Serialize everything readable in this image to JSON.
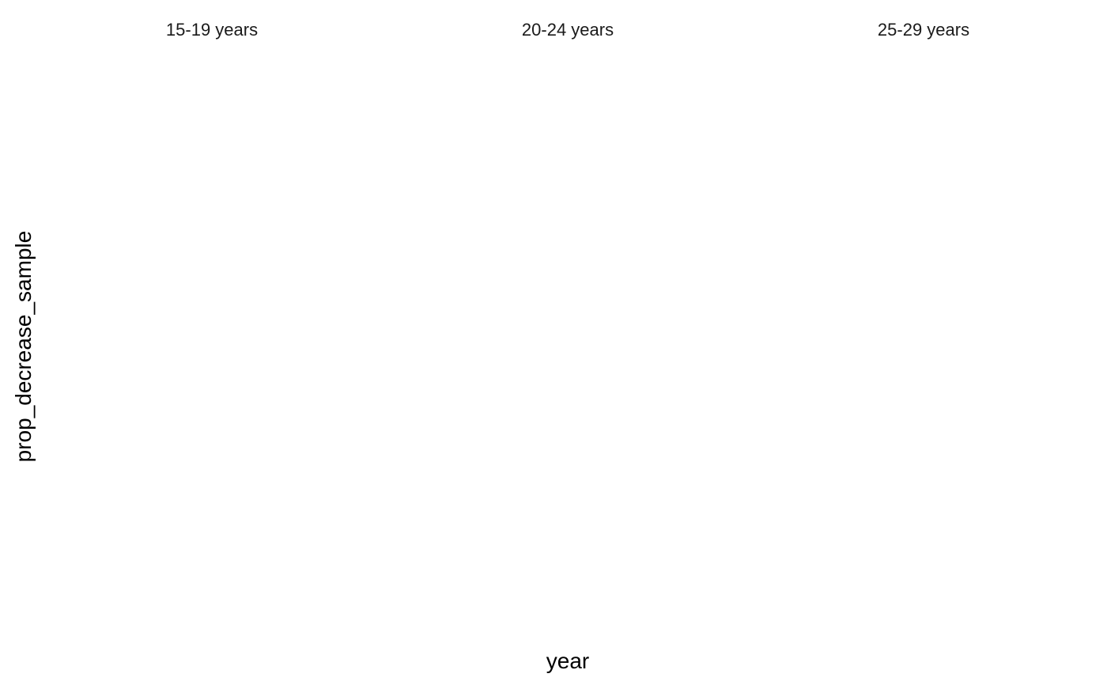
{
  "chart_data": {
    "type": "line",
    "facets": [
      "15-19 years",
      "20-24 years",
      "25-29 years"
    ],
    "xlabel": "year",
    "ylabel": "prop_decrease_sample",
    "series": [],
    "grid": false
  },
  "colors": {
    "background": "#ffffff",
    "text": "#1a1a1a",
    "axis_title": "#000000"
  }
}
